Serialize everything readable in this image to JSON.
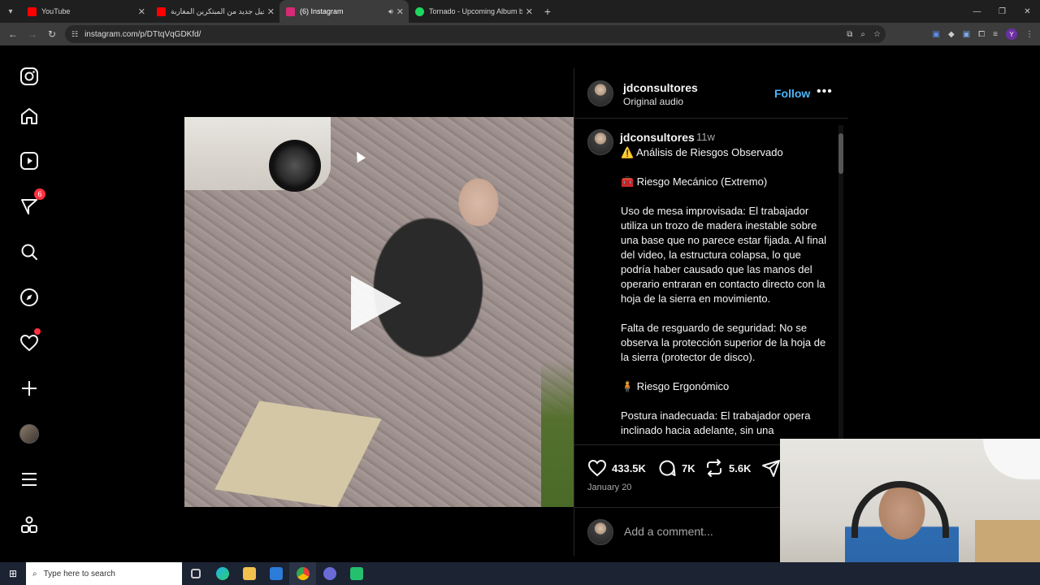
{
  "browser": {
    "tabs": [
      {
        "title": "YouTube",
        "color": "#ff0000",
        "active": false
      },
      {
        "title": "جيل جديد من المبتكرين المغاربة",
        "color": "#ff0000",
        "active": false
      },
      {
        "title": "(6) Instagram",
        "color": "#d62976",
        "active": true
      },
      {
        "title": "Tornado - Upcoming Album by",
        "color": "#1ed760",
        "active": false
      }
    ],
    "url": "instagram.com/p/DTtqVqGDKfd/"
  },
  "sidebar": {
    "notification_count": "6"
  },
  "post": {
    "author": "jdconsultores",
    "audio": "Original audio",
    "follow_label": "Follow",
    "more_label": "•••",
    "time_ago": "11w",
    "caption": [
      "⚠️ Análisis de Riesgos Observado",
      "🧰 Riesgo Mecánico (Extremo)",
      "Uso de mesa improvisada: El trabajador utiliza un trozo de madera inestable sobre una base que no parece estar fijada. Al final del video, la estructura colapsa, lo que podría haber causado que las manos del operario entraran en contacto directo con la hoja de la sierra en movimiento.",
      "Falta de resguardo de seguridad: No se observa la protección superior de la hoja de la sierra (protector de disco).",
      "🧍 Riesgo Ergonómico",
      "Postura inadecuada: El trabajador opera inclinado hacia adelante, sin una"
    ],
    "likes": "433.5K",
    "comments": "7K",
    "reposts": "5.6K",
    "date": "January 20",
    "comment_placeholder": "Add a comment..."
  },
  "taskbar": {
    "search_placeholder": "Type here to search"
  }
}
